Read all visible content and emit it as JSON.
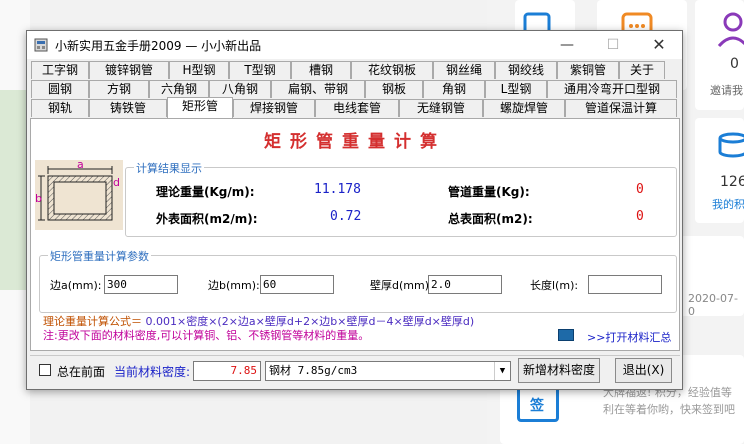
{
  "window": {
    "title": "小新实用五金手册2009 — 小小新出品",
    "controls": {
      "minimize": "—",
      "maximize": "☐",
      "close": "✕"
    }
  },
  "tabs": {
    "row1": [
      "工字钢",
      "镀锌钢管",
      "H型钢",
      "T型钢",
      "槽钢",
      "花纹钢板",
      "钢丝绳",
      "钢绞线",
      "紫铜管",
      "关于"
    ],
    "row2": [
      "圆钢",
      "方钢",
      "六角钢",
      "八角钢",
      "扁钢、带钢",
      "钢板",
      "角钢",
      "L型钢",
      "通用冷弯开口型钢"
    ],
    "row3": [
      "钢轨",
      "铸铁管",
      "矩形管",
      "焊接钢管",
      "电线套管",
      "无缝钢管",
      "螺旋焊管",
      "管道保温计算"
    ],
    "active": "矩形管"
  },
  "page_title": "矩形管重量计算",
  "diagram": {
    "label_a": "a",
    "label_b": "b",
    "label_d": "d"
  },
  "results": {
    "legend": "计算结果显示",
    "theoretical_weight_label": "理论重量(Kg/m):",
    "theoretical_weight_value": "11.178",
    "outer_area_label": "外表面积(m2/m):",
    "outer_area_value": "0.72",
    "pipe_weight_label": "管道重量(Kg):",
    "pipe_weight_value": "0",
    "total_area_label": "总表面积(m2):",
    "total_area_value": "0"
  },
  "params": {
    "legend": "矩形管重量计算参数",
    "side_a_label": "边a(mm):",
    "side_a_value": "300",
    "side_b_label": "边b(mm):",
    "side_b_value": "60",
    "wall_label": "壁厚d(mm):",
    "wall_value": "2.0",
    "length_label": "长度l(m):",
    "length_value": ""
  },
  "formula": {
    "label": "理论重量计算公式＝",
    "text": "0.001×密度×(2×边a×壁厚d+2×边b×壁厚d－4×壁厚d×壁厚d)"
  },
  "note": "注:更改下面的材料密度,可以计算铜、铝、不锈钢管等材料的重量。",
  "open_summary": ">>打开材料汇总",
  "bottom": {
    "on_top_label": "总在前面",
    "density_label": "当前材料密度:",
    "density_value": "7.85",
    "material_selected": "钢材 7.85g/cm3",
    "add_density_button": "新增材料密度",
    "exit_button": "退出(X)"
  },
  "background": {
    "count": "0",
    "invite_label": "邀请我",
    "number2": "126",
    "my_label": "我的积",
    "date": "2020-07-0",
    "promo_line1": "大牌福返! 积分，经验值等",
    "promo_line2": "利在等着你哟，快来签到吧"
  },
  "colors": {
    "title_red": "#d42f2f",
    "value_blue": "#1a22c8",
    "value_red": "#dd1111",
    "legend_blue": "#2f6fbf"
  }
}
